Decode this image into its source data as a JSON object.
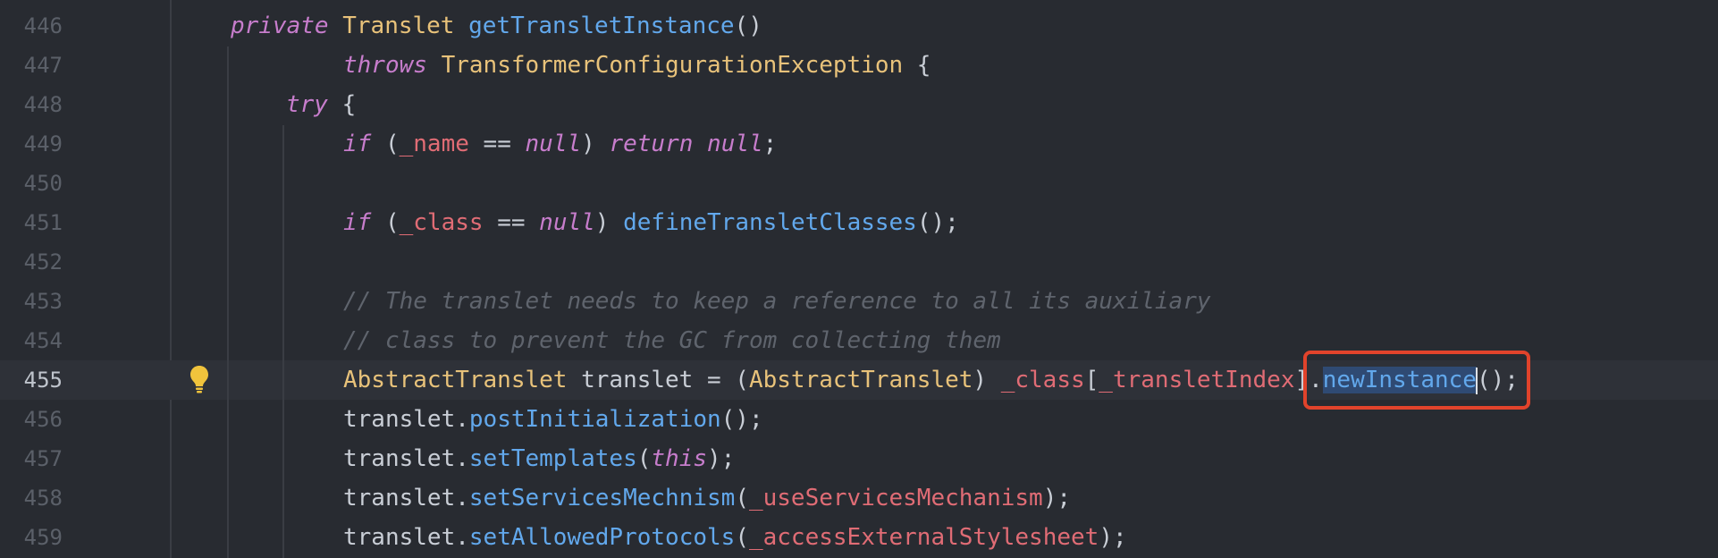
{
  "editor": {
    "current_line": "455",
    "lines": [
      {
        "number": "446",
        "tokens": [
          {
            "cls": "kw",
            "text": "private"
          },
          {
            "cls": "pl",
            "text": " "
          },
          {
            "cls": "ty",
            "text": "Translet"
          },
          {
            "cls": "pl",
            "text": " "
          },
          {
            "cls": "fn",
            "text": "getTransletInstance"
          },
          {
            "cls": "pl",
            "text": "()"
          }
        ]
      },
      {
        "number": "447",
        "tokens": [
          {
            "cls": "kw",
            "text": "throws"
          },
          {
            "cls": "pl",
            "text": " "
          },
          {
            "cls": "ty",
            "text": "TransformerConfigurationException"
          },
          {
            "cls": "pl",
            "text": " {"
          }
        ]
      },
      {
        "number": "448",
        "tokens": [
          {
            "cls": "kw",
            "text": "try"
          },
          {
            "cls": "pl",
            "text": " {"
          }
        ]
      },
      {
        "number": "449",
        "tokens": [
          {
            "cls": "kw",
            "text": "if"
          },
          {
            "cls": "pl",
            "text": " ("
          },
          {
            "cls": "fld",
            "text": "_name"
          },
          {
            "cls": "pl",
            "text": " == "
          },
          {
            "cls": "kw",
            "text": "null"
          },
          {
            "cls": "pl",
            "text": ") "
          },
          {
            "cls": "kw",
            "text": "return"
          },
          {
            "cls": "pl",
            "text": " "
          },
          {
            "cls": "kw",
            "text": "null"
          },
          {
            "cls": "pl",
            "text": ";"
          }
        ]
      },
      {
        "number": "450",
        "tokens": []
      },
      {
        "number": "451",
        "tokens": [
          {
            "cls": "kw",
            "text": "if"
          },
          {
            "cls": "pl",
            "text": " ("
          },
          {
            "cls": "fld",
            "text": "_class"
          },
          {
            "cls": "pl",
            "text": " == "
          },
          {
            "cls": "kw",
            "text": "null"
          },
          {
            "cls": "pl",
            "text": ") "
          },
          {
            "cls": "fn",
            "text": "defineTransletClasses"
          },
          {
            "cls": "pl",
            "text": "();"
          }
        ]
      },
      {
        "number": "452",
        "tokens": []
      },
      {
        "number": "453",
        "tokens": [
          {
            "cls": "cm",
            "text": "// The translet needs to keep a reference to all its auxiliary"
          }
        ]
      },
      {
        "number": "454",
        "tokens": [
          {
            "cls": "cm",
            "text": "// class to prevent the GC from collecting them"
          }
        ]
      },
      {
        "number": "455",
        "tokens": [
          {
            "cls": "ty",
            "text": "AbstractTranslet"
          },
          {
            "cls": "pl",
            "text": " translet = ("
          },
          {
            "cls": "ty",
            "text": "AbstractTranslet"
          },
          {
            "cls": "pl",
            "text": ") "
          },
          {
            "cls": "fld",
            "text": "_class"
          },
          {
            "cls": "pl",
            "text": "["
          },
          {
            "cls": "fld",
            "text": "_transletIndex"
          },
          {
            "cls": "pl",
            "text": "]."
          },
          {
            "cls": "fn sel",
            "text": "newInstance"
          },
          {
            "cls": "caret",
            "text": ""
          },
          {
            "cls": "pl",
            "text": "();"
          }
        ]
      },
      {
        "number": "456",
        "tokens": [
          {
            "cls": "pl",
            "text": "translet."
          },
          {
            "cls": "fn",
            "text": "postInitialization"
          },
          {
            "cls": "pl",
            "text": "();"
          }
        ]
      },
      {
        "number": "457",
        "tokens": [
          {
            "cls": "pl",
            "text": "translet."
          },
          {
            "cls": "fn",
            "text": "setTemplates"
          },
          {
            "cls": "pl",
            "text": "("
          },
          {
            "cls": "kw",
            "text": "this"
          },
          {
            "cls": "pl",
            "text": ");"
          }
        ]
      },
      {
        "number": "458",
        "tokens": [
          {
            "cls": "pl",
            "text": "translet."
          },
          {
            "cls": "fn",
            "text": "setServicesMechnism"
          },
          {
            "cls": "pl",
            "text": "("
          },
          {
            "cls": "fld",
            "text": "_useServicesMechanism"
          },
          {
            "cls": "pl",
            "text": ");"
          }
        ]
      },
      {
        "number": "459",
        "tokens": [
          {
            "cls": "pl",
            "text": "translet."
          },
          {
            "cls": "fn",
            "text": "setAllowedProtocols"
          },
          {
            "cls": "pl",
            "text": "("
          },
          {
            "cls": "fld",
            "text": "_accessExternalStylesheet"
          },
          {
            "cls": "pl",
            "text": ");"
          }
        ]
      }
    ]
  },
  "icons": {
    "intention_bulb": "lightbulb-icon"
  },
  "colors": {
    "background": "#282b31",
    "highlight_box": "#e1432b",
    "keyword": "#c77dcc",
    "type": "#e8c27a",
    "method": "#62a8ec",
    "field": "#e06c75",
    "comment": "#5f646d"
  }
}
